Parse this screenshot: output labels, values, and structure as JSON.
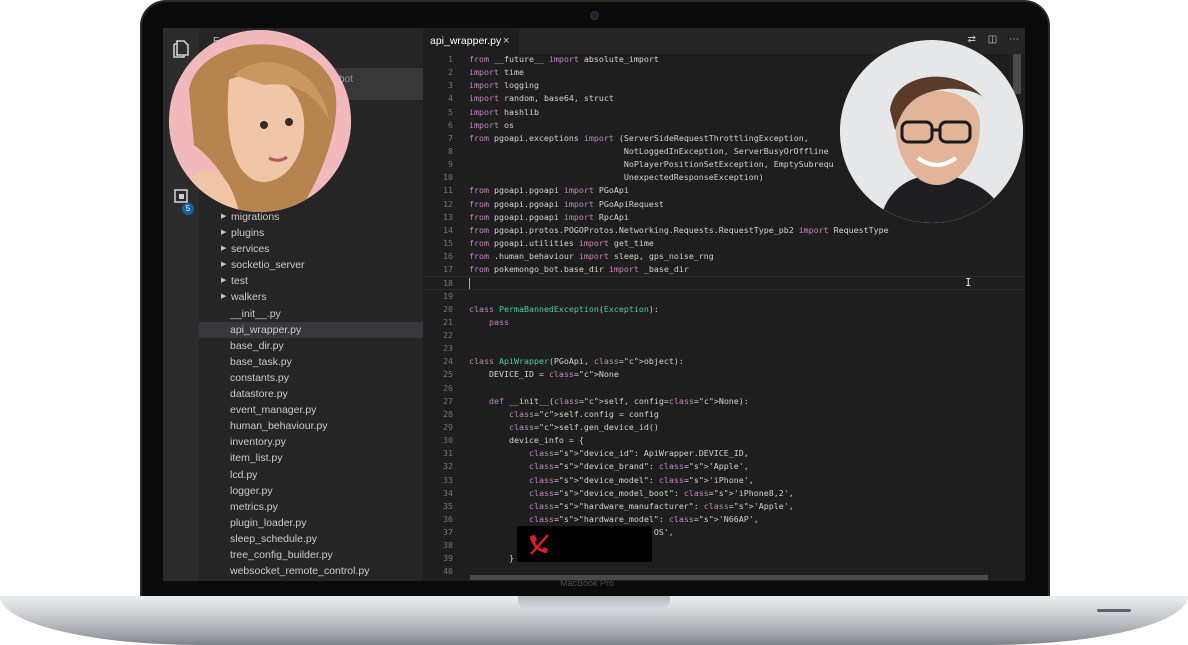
{
  "explorer": {
    "title": "Ex",
    "project_fragment": "bot",
    "scm_badge": "5",
    "items": [
      {
        "label": "migrations",
        "type": "folder"
      },
      {
        "label": "plugins",
        "type": "folder"
      },
      {
        "label": "services",
        "type": "folder"
      },
      {
        "label": "socketio_server",
        "type": "folder"
      },
      {
        "label": "test",
        "type": "folder"
      },
      {
        "label": "walkers",
        "type": "folder"
      },
      {
        "label": "__init__.py",
        "type": "file"
      },
      {
        "label": "api_wrapper.py",
        "type": "file",
        "selected": true
      },
      {
        "label": "base_dir.py",
        "type": "file"
      },
      {
        "label": "base_task.py",
        "type": "file"
      },
      {
        "label": "constants.py",
        "type": "file"
      },
      {
        "label": "datastore.py",
        "type": "file"
      },
      {
        "label": "event_manager.py",
        "type": "file"
      },
      {
        "label": "human_behaviour.py",
        "type": "file"
      },
      {
        "label": "inventory.py",
        "type": "file"
      },
      {
        "label": "item_list.py",
        "type": "file"
      },
      {
        "label": "lcd.py",
        "type": "file"
      },
      {
        "label": "logger.py",
        "type": "file"
      },
      {
        "label": "metrics.py",
        "type": "file"
      },
      {
        "label": "plugin_loader.py",
        "type": "file"
      },
      {
        "label": "sleep_schedule.py",
        "type": "file"
      },
      {
        "label": "tree_config_builder.py",
        "type": "file"
      },
      {
        "label": "websocket_remote_control.py",
        "type": "file"
      }
    ]
  },
  "editor": {
    "tab_label": "api_wrapper.py",
    "tab_close": "×",
    "current_line": 18,
    "lines": [
      {
        "n": "1",
        "text": "from __future__ import absolute_import"
      },
      {
        "n": "2",
        "text": "import time"
      },
      {
        "n": "3",
        "text": "import logging"
      },
      {
        "n": "4",
        "text": "import random, base64, struct"
      },
      {
        "n": "5",
        "text": "import hashlib"
      },
      {
        "n": "6",
        "text": "import os"
      },
      {
        "n": "7",
        "text": "from pgoapi.exceptions import (ServerSideRequestThrottlingException,"
      },
      {
        "n": "8",
        "text": "                               NotLoggedInException, ServerBusyOrOffline"
      },
      {
        "n": "9",
        "text": "                               NoPlayerPositionSetException, EmptySubrequ"
      },
      {
        "n": "10",
        "text": "                               UnexpectedResponseException)"
      },
      {
        "n": "11",
        "text": "from pgoapi.pgoapi import PGoApi"
      },
      {
        "n": "12",
        "text": "from pgoapi.pgoapi import PGoApiRequest"
      },
      {
        "n": "13",
        "text": "from pgoapi.pgoapi import RpcApi"
      },
      {
        "n": "14",
        "text": "from pgoapi.protos.POGOProtos.Networking.Requests.RequestType_pb2 import RequestType"
      },
      {
        "n": "15",
        "text": "from pgoapi.utilities import get_time"
      },
      {
        "n": "16",
        "text": "from .human_behaviour import sleep, gps_noise_rng"
      },
      {
        "n": "17",
        "text": "from pokemongo_bot.base_dir import _base_dir"
      },
      {
        "n": "18",
        "text": ""
      },
      {
        "n": "19",
        "text": ""
      },
      {
        "n": "20",
        "text": "class PermaBannedException(Exception):"
      },
      {
        "n": "21",
        "text": "    pass"
      },
      {
        "n": "22",
        "text": ""
      },
      {
        "n": "23",
        "text": ""
      },
      {
        "n": "24",
        "text": "class ApiWrapper(PGoApi, object):"
      },
      {
        "n": "25",
        "text": "    DEVICE_ID = None"
      },
      {
        "n": "26",
        "text": ""
      },
      {
        "n": "27",
        "text": "    def __init__(self, config=None):"
      },
      {
        "n": "28",
        "text": "        self.config = config"
      },
      {
        "n": "29",
        "text": "        self.gen_device_id()"
      },
      {
        "n": "30",
        "text": "        device_info = {"
      },
      {
        "n": "31",
        "text": "            \"device_id\": ApiWrapper.DEVICE_ID,"
      },
      {
        "n": "32",
        "text": "            \"device_brand\": 'Apple',"
      },
      {
        "n": "33",
        "text": "            \"device_model\": 'iPhone',"
      },
      {
        "n": "34",
        "text": "            \"device_model_boot\": 'iPhone8,2',"
      },
      {
        "n": "35",
        "text": "            \"hardware_manufacturer\": 'Apple',"
      },
      {
        "n": "36",
        "text": "            \"hardware_model\": 'N66AP',"
      },
      {
        "n": "37",
        "text": "                                  ne OS',"
      },
      {
        "n": "38",
        "text": "                                  ',"
      },
      {
        "n": "39",
        "text": "        }"
      },
      {
        "n": "40",
        "text": ""
      }
    ]
  },
  "colors": {
    "keyword": "#c586c0",
    "string": "#ce9178",
    "constant": "#569cd6",
    "type": "#4ec9b0",
    "end_call": "#d21f26"
  },
  "call": {
    "participants": 2,
    "controls": [
      "end-call-icon"
    ]
  },
  "brand_label": "MacBook Pro"
}
